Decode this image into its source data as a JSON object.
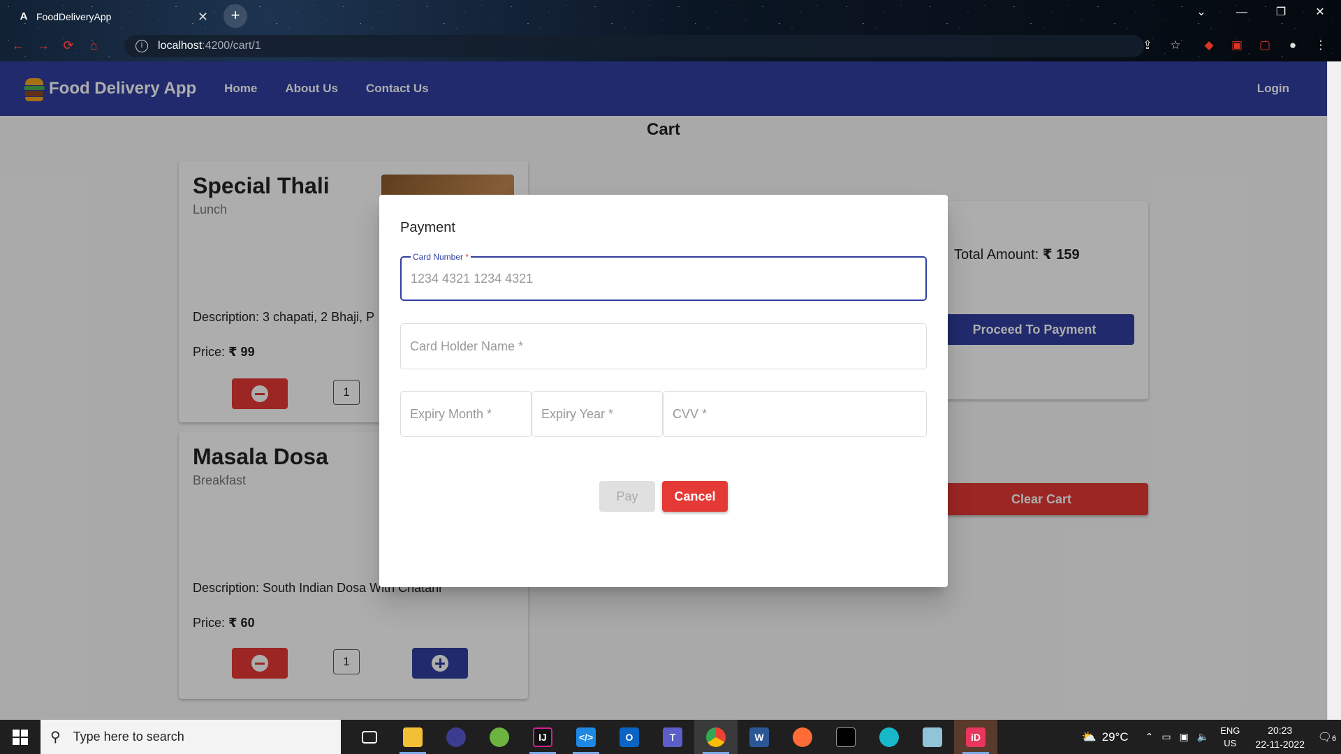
{
  "browser": {
    "tab_title": "FoodDeliveryApp",
    "url_host": "localhost",
    "url_path": ":4200/cart/1"
  },
  "navbar": {
    "brand": "Food Delivery App",
    "links": [
      "Home",
      "About Us",
      "Contact Us"
    ],
    "login": "Login"
  },
  "page": {
    "title": "Cart"
  },
  "cart_items": [
    {
      "name": "Special Thali",
      "category": "Lunch",
      "description": "Description: 3 chapati, 2 Bhaji, P",
      "price_label": "Price:",
      "price": "₹ 99",
      "quantity": "1"
    },
    {
      "name": "Masala Dosa",
      "category": "Breakfast",
      "description": "Description: South Indian Dosa With Chatani",
      "price_label": "Price:",
      "price": "₹ 60",
      "quantity": "1"
    }
  ],
  "summary": {
    "total_label": "Total Amount:",
    "total_value": "₹ 159",
    "proceed_label": "Proceed To Payment",
    "clear_label": "Clear Cart"
  },
  "dialog": {
    "title": "Payment",
    "card_number_label": "Card Number",
    "card_number_placeholder": "1234 4321 1234 4321",
    "card_holder_placeholder": "Card Holder Name *",
    "expiry_month_placeholder": "Expiry Month *",
    "expiry_year_placeholder": "Expiry Year *",
    "cvv_placeholder": "CVV *",
    "pay_label": "Pay",
    "cancel_label": "Cancel"
  },
  "taskbar": {
    "search_placeholder": "Type here to search",
    "temperature": "29°C",
    "lang_line1": "ENG",
    "lang_line2": "US",
    "time": "20:23",
    "date": "22-11-2022",
    "notification_count": "6"
  },
  "colors": {
    "primary": "#303f9f",
    "warn": "#e53935"
  }
}
